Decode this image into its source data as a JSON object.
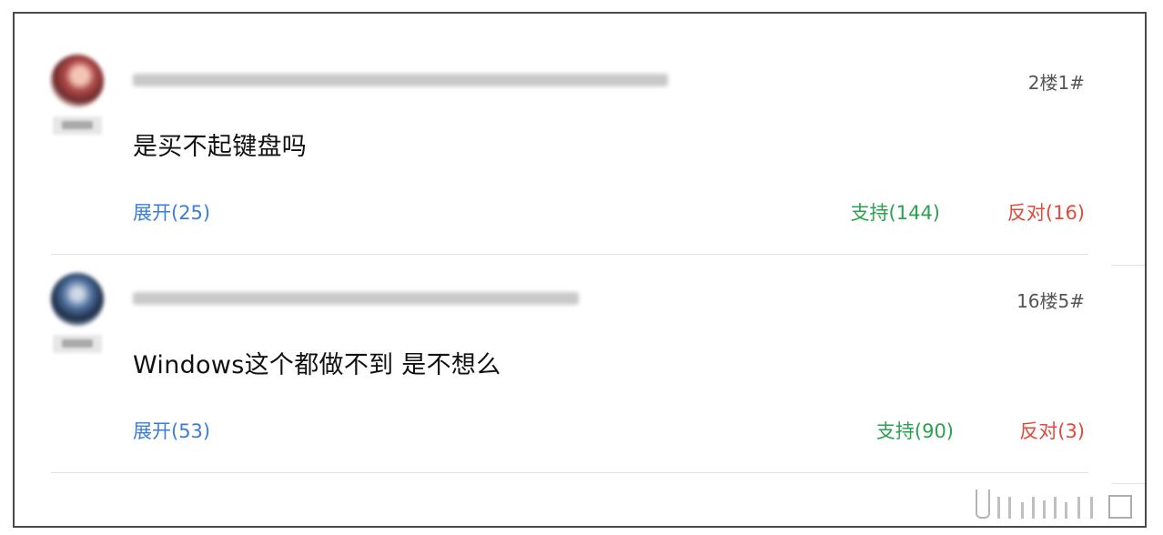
{
  "comments": [
    {
      "floor": "2楼1#",
      "content": "是买不起键盘吗",
      "expand": "展开(25)",
      "support": "支持(144)",
      "oppose": "反对(16)"
    },
    {
      "floor": "16楼5#",
      "content": "Windows这个都做不到 是不想么",
      "expand": "展开(53)",
      "support": "支持(90)",
      "oppose": "反对(3)"
    }
  ],
  "colors": {
    "expand": "#3b7dd8",
    "support": "#2aa14f",
    "oppose": "#e04a3c",
    "border": "#4a4a4a"
  }
}
